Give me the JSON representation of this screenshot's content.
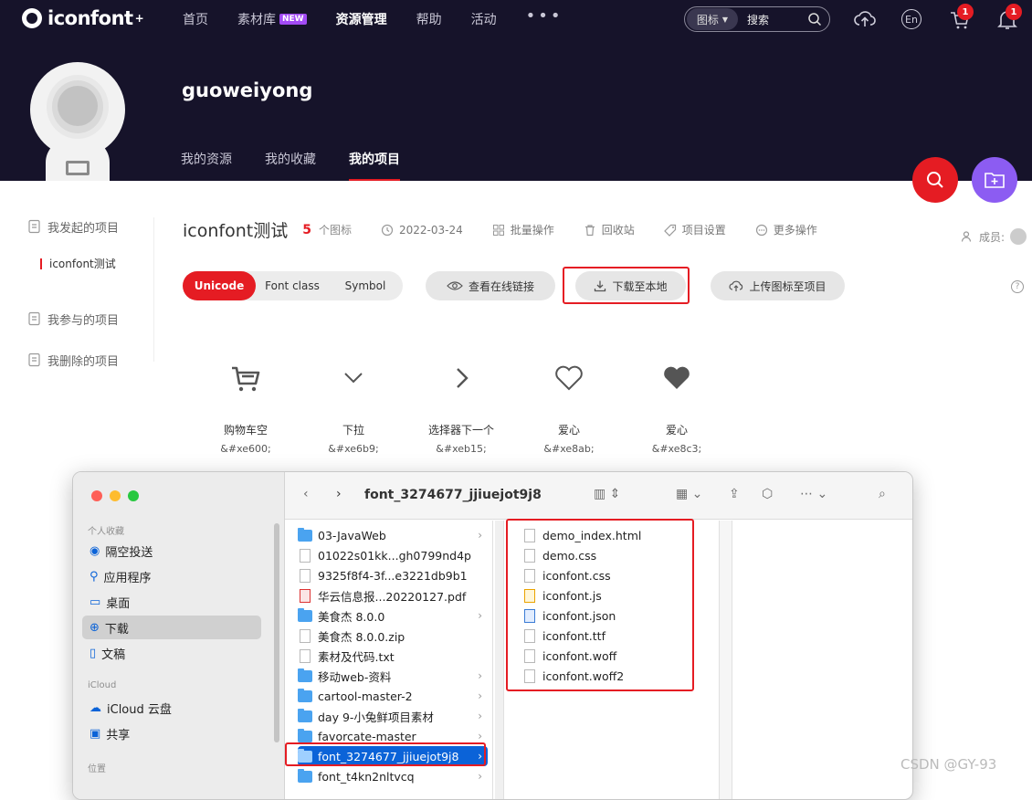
{
  "brand": "iconfont",
  "brand_plus": "+",
  "nav": {
    "items": [
      "首页",
      "素材库",
      "资源管理",
      "帮助",
      "活动"
    ],
    "new_badge": "NEW",
    "more": "•••"
  },
  "search": {
    "type": "图标",
    "placeholder": "搜索"
  },
  "header_icons": {
    "lang": "En",
    "cart_count": "1",
    "bell_count": "1"
  },
  "profile": {
    "username": "guoweiyong",
    "tabs": [
      "我的资源",
      "我的收藏",
      "我的项目"
    ],
    "active_tab": "我的项目"
  },
  "sidebar": {
    "items": [
      "我发起的项目",
      "iconfont测试",
      "我参与的项目",
      "我删除的项目"
    ]
  },
  "project": {
    "title": "iconfont测试",
    "count": "5",
    "count_unit": "个图标",
    "date": "2022-03-24",
    "actions": [
      "批量操作",
      "回收站",
      "项目设置",
      "更多操作"
    ],
    "members_label": "成员:"
  },
  "modes": [
    "Unicode",
    "Font class",
    "Symbol"
  ],
  "buttons": {
    "view_link": "查看在线链接",
    "download": "下载至本地",
    "upload": "上传图标至项目"
  },
  "icons": [
    {
      "name": "购物车空",
      "code": "&#xe600;",
      "icon": "cart-icon"
    },
    {
      "name": "下拉",
      "code": "&#xe6b9;",
      "icon": "chevron-down-icon"
    },
    {
      "name": "选择器下一个",
      "code": "&#xeb15;",
      "icon": "chevron-right-icon"
    },
    {
      "name": "爱心",
      "code": "&#xe8ab;",
      "icon": "heart-outline-icon"
    },
    {
      "name": "爱心",
      "code": "&#xe8c3;",
      "icon": "heart-filled-icon"
    }
  ],
  "finder": {
    "title": "font_3274677_jjiuejot9j8",
    "favorites_label": "个人收藏",
    "favorites": [
      "隔空投送",
      "应用程序",
      "桌面",
      "下载",
      "文稿"
    ],
    "icloud_label": "iCloud",
    "icloud": [
      "iCloud 云盘",
      "共享"
    ],
    "locations_label": "位置",
    "column1": [
      {
        "name": "03-JavaWeb",
        "kind": "folder"
      },
      {
        "name": "01022s01kk...gh0799nd4p",
        "kind": "file"
      },
      {
        "name": "9325f8f4-3f...e3221db9b1",
        "kind": "file"
      },
      {
        "name": "华云信息报...20220127.pdf",
        "kind": "pdf"
      },
      {
        "name": "美食杰 8.0.0",
        "kind": "folder"
      },
      {
        "name": "美食杰 8.0.0.zip",
        "kind": "file"
      },
      {
        "name": "素材及代码.txt",
        "kind": "file"
      },
      {
        "name": "移动web-资料",
        "kind": "folder"
      },
      {
        "name": "cartool-master-2",
        "kind": "folder"
      },
      {
        "name": "day 9-小兔鲜项目素材",
        "kind": "folder"
      },
      {
        "name": "favorcate-master",
        "kind": "folder"
      },
      {
        "name": "font_3274677_jjiuejot9j8",
        "kind": "folder"
      },
      {
        "name": "font_t4kn2nltvcq",
        "kind": "folder"
      }
    ],
    "column2": [
      {
        "name": "demo_index.html",
        "kind": "file"
      },
      {
        "name": "demo.css",
        "kind": "file"
      },
      {
        "name": "iconfont.css",
        "kind": "file"
      },
      {
        "name": "iconfont.js",
        "kind": "js"
      },
      {
        "name": "iconfont.json",
        "kind": "json"
      },
      {
        "name": "iconfont.ttf",
        "kind": "file"
      },
      {
        "name": "iconfont.woff",
        "kind": "file"
      },
      {
        "name": "iconfont.woff2",
        "kind": "file"
      }
    ]
  },
  "watermark": "CSDN @GY-93",
  "colors": {
    "accent": "#e51c23",
    "header_bg": "#16132a",
    "purple": "#8c5cf2",
    "finder_select": "#0b63d8"
  }
}
